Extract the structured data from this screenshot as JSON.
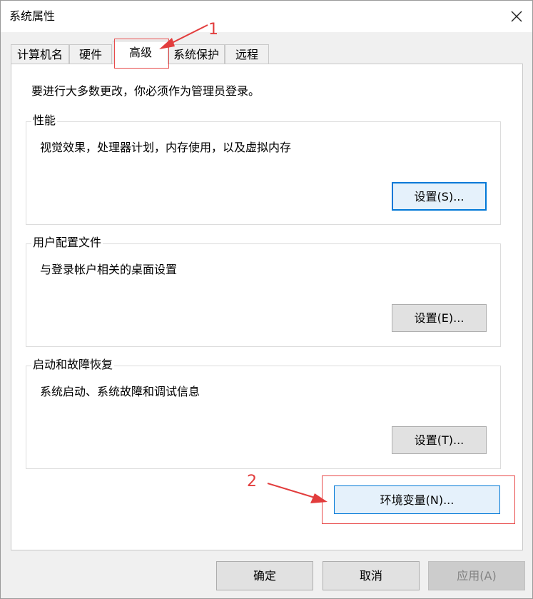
{
  "window": {
    "title": "系统属性",
    "close_icon": "close-icon"
  },
  "tabs": [
    {
      "label": "计算机名",
      "active": false
    },
    {
      "label": "硬件",
      "active": false
    },
    {
      "label": "高级",
      "active": true
    },
    {
      "label": "系统保护",
      "active": false
    },
    {
      "label": "远程",
      "active": false
    }
  ],
  "advanced": {
    "admin_note": "要进行大多数更改，你必须作为管理员登录。",
    "performance": {
      "title": "性能",
      "description": "视觉效果，处理器计划，内存使用，以及虚拟内存",
      "settings_label": "设置(S)..."
    },
    "user_profiles": {
      "title": "用户配置文件",
      "description": "与登录帐户相关的桌面设置",
      "settings_label": "设置(E)..."
    },
    "startup_recovery": {
      "title": "启动和故障恢复",
      "description": "系统启动、系统故障和调试信息",
      "settings_label": "设置(T)..."
    },
    "env_vars_label": "环境变量(N)..."
  },
  "footer": {
    "ok_label": "确定",
    "cancel_label": "取消",
    "apply_label": "应用(A)"
  },
  "annotations": {
    "step1": "1",
    "step2": "2",
    "color": "#e23d3d"
  }
}
